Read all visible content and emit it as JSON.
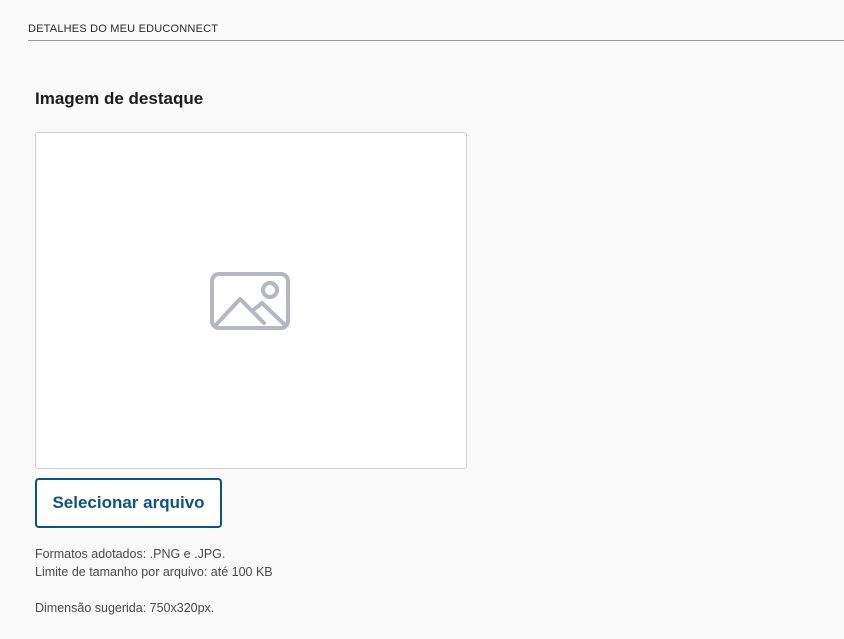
{
  "section": {
    "title": "DETALHES DO MEU EDUCONNECT"
  },
  "featured_image": {
    "title": "Imagem de destaque",
    "placeholder_icon": "image-icon",
    "select_button_label": "Selecionar arquivo",
    "formats_text": "Formatos adotados: .PNG e .JPG.",
    "size_limit_text": "Limite de tamanho por arquivo: até 100 KB",
    "dimension_text": "Dimensão sugerida: 750x320px."
  },
  "colors": {
    "accent": "#0c5486",
    "placeholder_icon": "#b4b7c4",
    "background": "#f9f9f9"
  }
}
